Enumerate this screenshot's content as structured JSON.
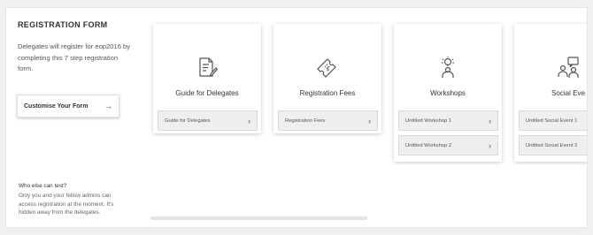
{
  "sidebar": {
    "title": "REGISTRATION FORM",
    "description": "Delegates will register for eop2016 by completing this 7 step registration form.",
    "customise_label": "Customise Your Form",
    "customise_icon": "arrow-right-icon"
  },
  "info": {
    "title": "Who else can test?",
    "text": "Only you and your fellow admins can access registration at the moment. It's hidden away from the delegates."
  },
  "cards": [
    {
      "label": "Guide for Delegates",
      "icon": "document-pen-icon",
      "items": [
        "Guide for Delegates"
      ]
    },
    {
      "label": "Registration Fees",
      "icon": "ticket-icon",
      "items": [
        "Registration Fees"
      ]
    },
    {
      "label": "Workshops",
      "icon": "presenter-idea-icon",
      "items": [
        "Untitled Workshop 1",
        "Untitled Workshop 2"
      ]
    },
    {
      "label": "Social Eve",
      "icon": "people-chat-icon",
      "items": [
        "Untitled Social Event 1",
        "Untitled Social Event 2"
      ]
    }
  ],
  "colors": {
    "card_bg": "#ffffff",
    "sub_bg": "#efefef",
    "page_bg": "#f0f0f0"
  }
}
